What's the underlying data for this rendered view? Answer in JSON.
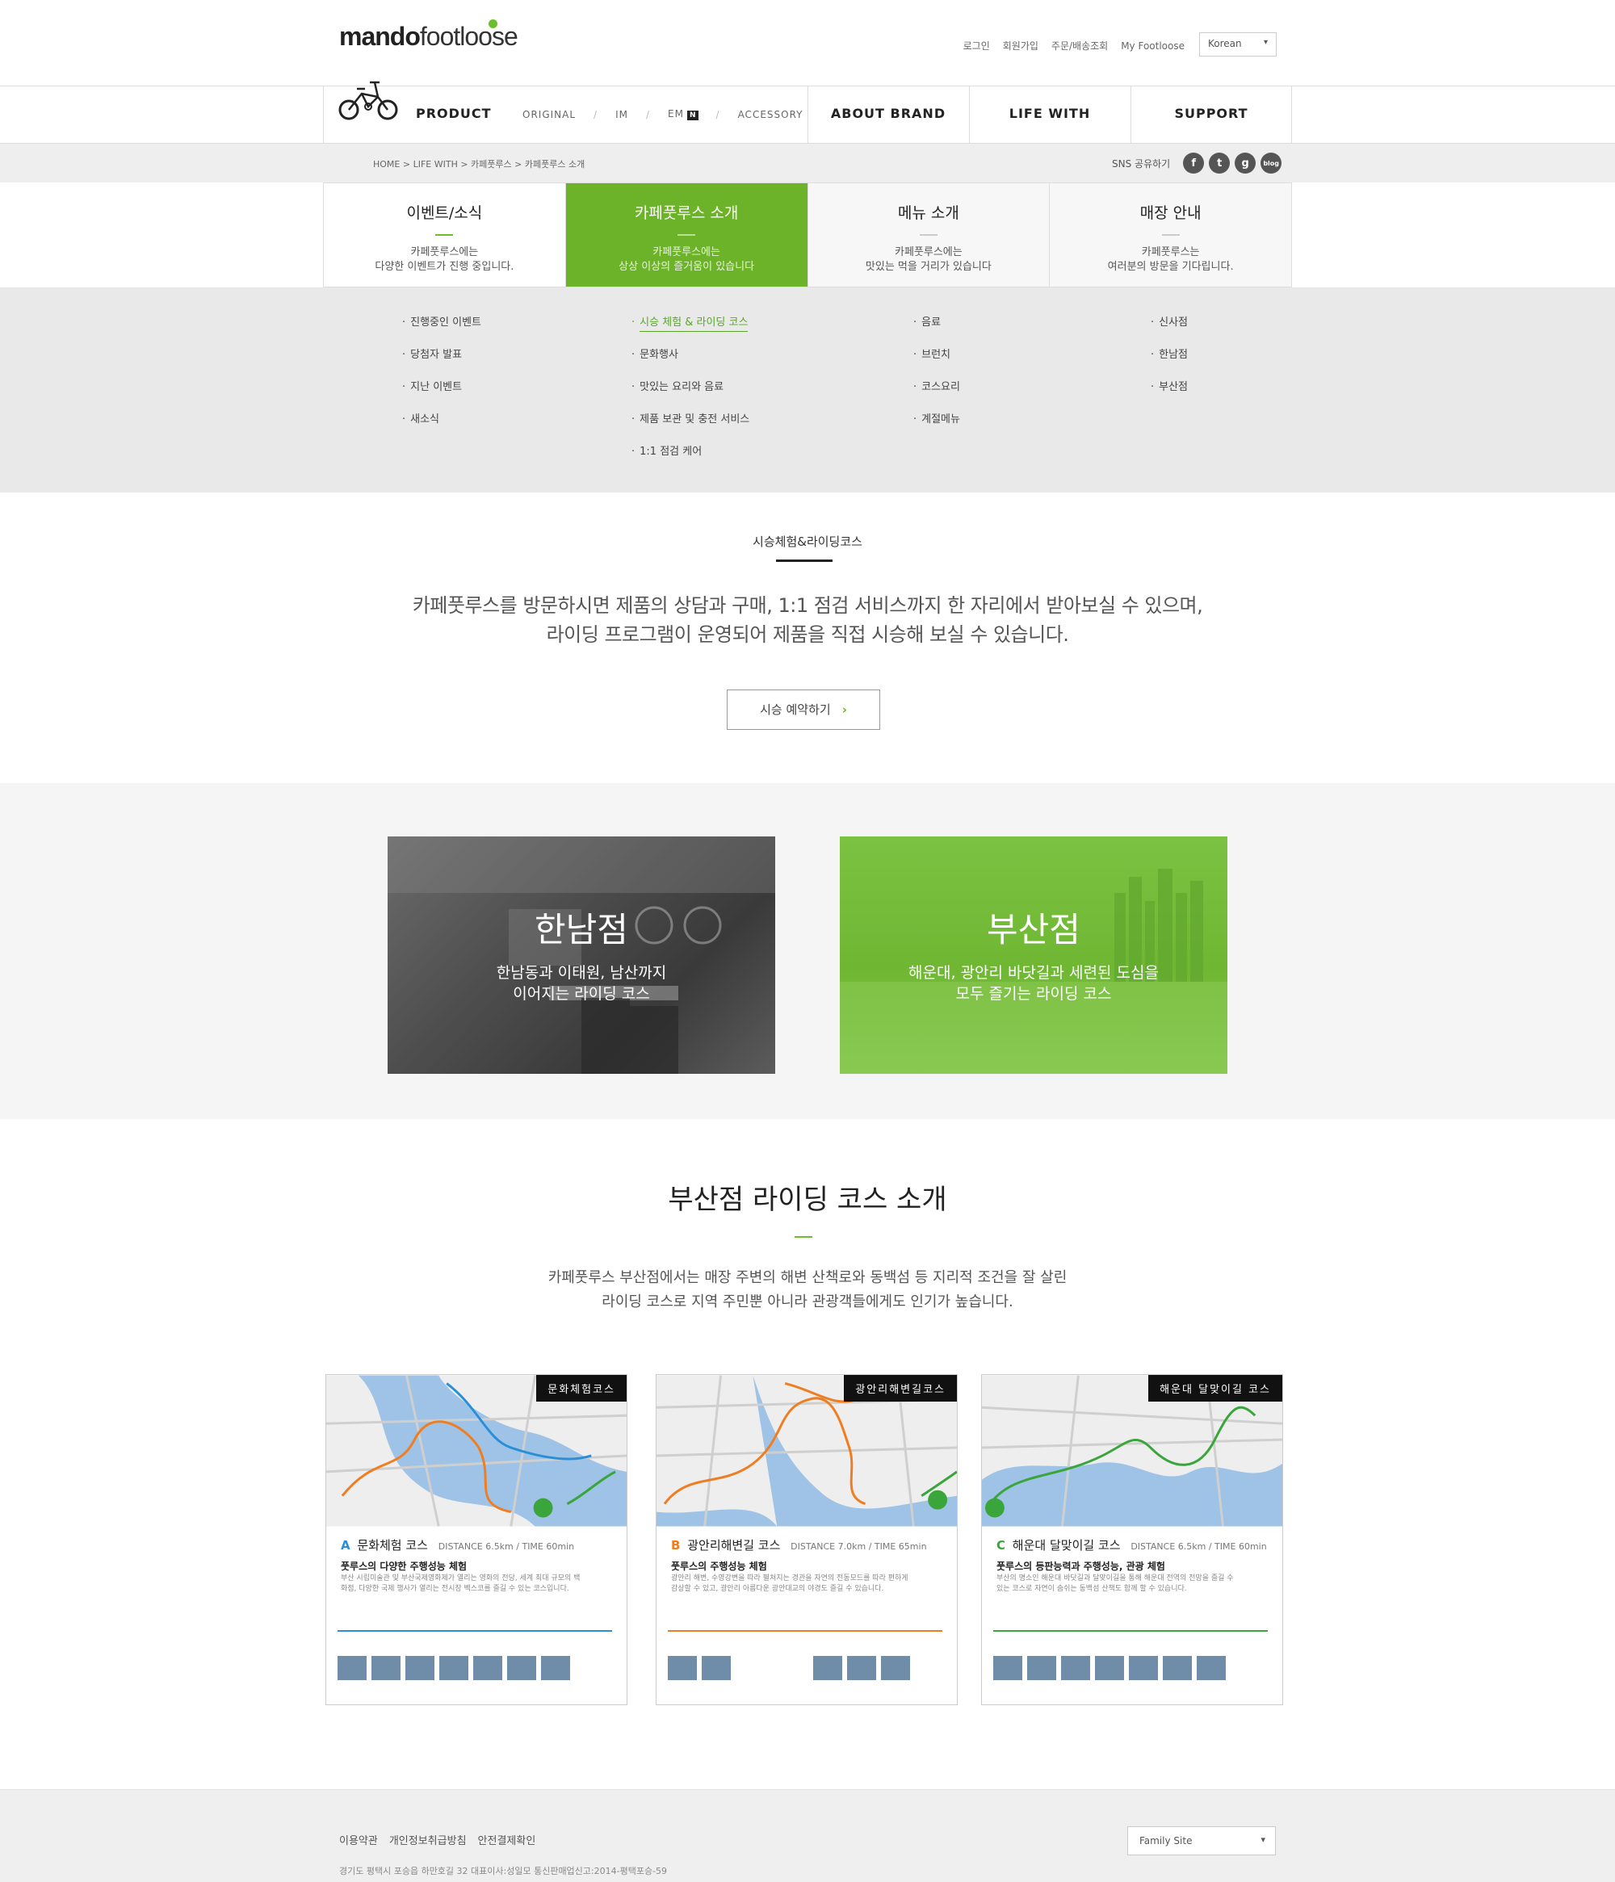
{
  "header": {
    "logo_brand": "mando",
    "logo_name": "footloose",
    "util_links": [
      "로그인",
      "회원가입",
      "주문/배송조회",
      "My Footloose"
    ],
    "language": "Korean"
  },
  "gnb": {
    "product": "PRODUCT",
    "sub": [
      "ORIGINAL",
      "IM",
      "EM",
      "ACCESSORY"
    ],
    "new_badge": "N",
    "menu": [
      "ABOUT BRAND",
      "LIFE WITH",
      "SUPPORT"
    ]
  },
  "location": {
    "breadcrumb": "HOME > LIFE WITH > 카페풋루스 > 카페풋루스 소개",
    "sns_label": "SNS 공유하기",
    "sns_icons": [
      "f",
      "t",
      "g",
      "blog"
    ]
  },
  "tabs": [
    {
      "title": "이벤트/소식",
      "desc1": "카페풋루스에는",
      "desc2": "다양한 이벤트가 진행 중입니다."
    },
    {
      "title": "카페풋루스 소개",
      "desc1": "카페풋루스에는",
      "desc2": "상상 이상의 즐거움이 있습니다"
    },
    {
      "title": "메뉴 소개",
      "desc1": "카페풋루스에는",
      "desc2": "맛있는 먹을 거리가 있습니다"
    },
    {
      "title": "매장 안내",
      "desc1": "카페풋루스는",
      "desc2": "여러분의 방문을 기다립니다."
    }
  ],
  "submenu": {
    "col1": [
      "진행중인 이벤트",
      "당첨자 발표",
      "지난 이벤트",
      "새소식"
    ],
    "col2": [
      "시승 체험 & 라이딩 코스",
      "문화행사",
      "맛있는 요리와 음료",
      "제품 보관 및 충전 서비스",
      "1:1 점검 케어"
    ],
    "col3": [
      "음료",
      "브런치",
      "코스요리",
      "계절메뉴"
    ],
    "col4": [
      "신사점",
      "한남점",
      "부산점"
    ]
  },
  "intro": {
    "title": "시승체험&라이딩코스",
    "line1": "카페풋루스를 방문하시면 제품의 상담과 구매, 1:1 점검 서비스까지 한 자리에서 받아보실 수 있으며,",
    "line2": "라이딩 프로그램이 운영되어 제품을 직접 시승해 보실 수 있습니다.",
    "button": "시승 예약하기"
  },
  "branches": [
    {
      "name": "한남점",
      "desc1": "한남동과 이태원, 남산까지",
      "desc2": "이어지는 라이딩 코스"
    },
    {
      "name": "부산점",
      "desc1": "해운대, 광안리 바닷길과 세련된 도심을",
      "desc2": "모두 즐기는 라이딩 코스"
    }
  ],
  "course": {
    "title": "부산점 라이딩 코스 소개",
    "desc1": "카페풋루스 부산점에서는 매장 주변의 해변 산책로와 동백섬 등 지리적 조건을 잘 살린",
    "desc2": "라이딩 코스로 지역 주민뿐 아니라 관광객들에게도 인기가 높습니다.",
    "cards": [
      {
        "tag": "문화체험코스",
        "letter": "A",
        "name": "문화체험 코스",
        "meta": "DISTANCE 6.5km / TIME 60min",
        "sub": "풋루스의 다양한 주행성능 체험",
        "desc": "부산 시립미술관 및 부산국제영화제가 열리는 영화의 전당, 세계 최대 규모의 백화점, 다양한 국제 행사가 열리는 전시장 벡스코를 즐길 수 있는 코스입니다.",
        "letter_color": "#2a8fd6"
      },
      {
        "tag": "광안리해변길코스",
        "letter": "B",
        "name": "광안리해변길 코스",
        "meta": "DISTANCE 7.0km / TIME 65min",
        "sub": "풋루스의 주행성능 체험",
        "desc": "광안리 해변, 수영강변을 따라 펼쳐지는 경관을 자연의 전동모드를 따라 편하게 감상할 수 있고, 광안리 아름다운 광안대교의 야경도 즐길 수 있습니다.",
        "letter_color": "#ef7d22"
      },
      {
        "tag": "해운대 달맞이길 코스",
        "letter": "C",
        "name": "해운대 달맞이길 코스",
        "meta": "DISTANCE 6.5km / TIME 60min",
        "sub": "풋루스의 등판능력과 주행성능, 관광 체험",
        "desc": "부산의 명소인 해운대 바닷길과 달맞이길을 통해 해운대 전역의 전망을 즐길 수 있는 코스로 자연이 숨쉬는 동백섬 산책도 함께 할 수 있습니다.",
        "letter_color": "#3aa53a"
      }
    ]
  },
  "footer": {
    "links": [
      "이용약관",
      "개인정보취급방침",
      "안전결제확인"
    ],
    "family_site": "Family Site",
    "address": "경기도 평택시 포승읍 하만호길 32   대표이사:성일모   통신판매업신고:2014-평택포승-59"
  },
  "colors": {
    "brand_green": "#6cb32a",
    "text_dark": "#222222"
  }
}
